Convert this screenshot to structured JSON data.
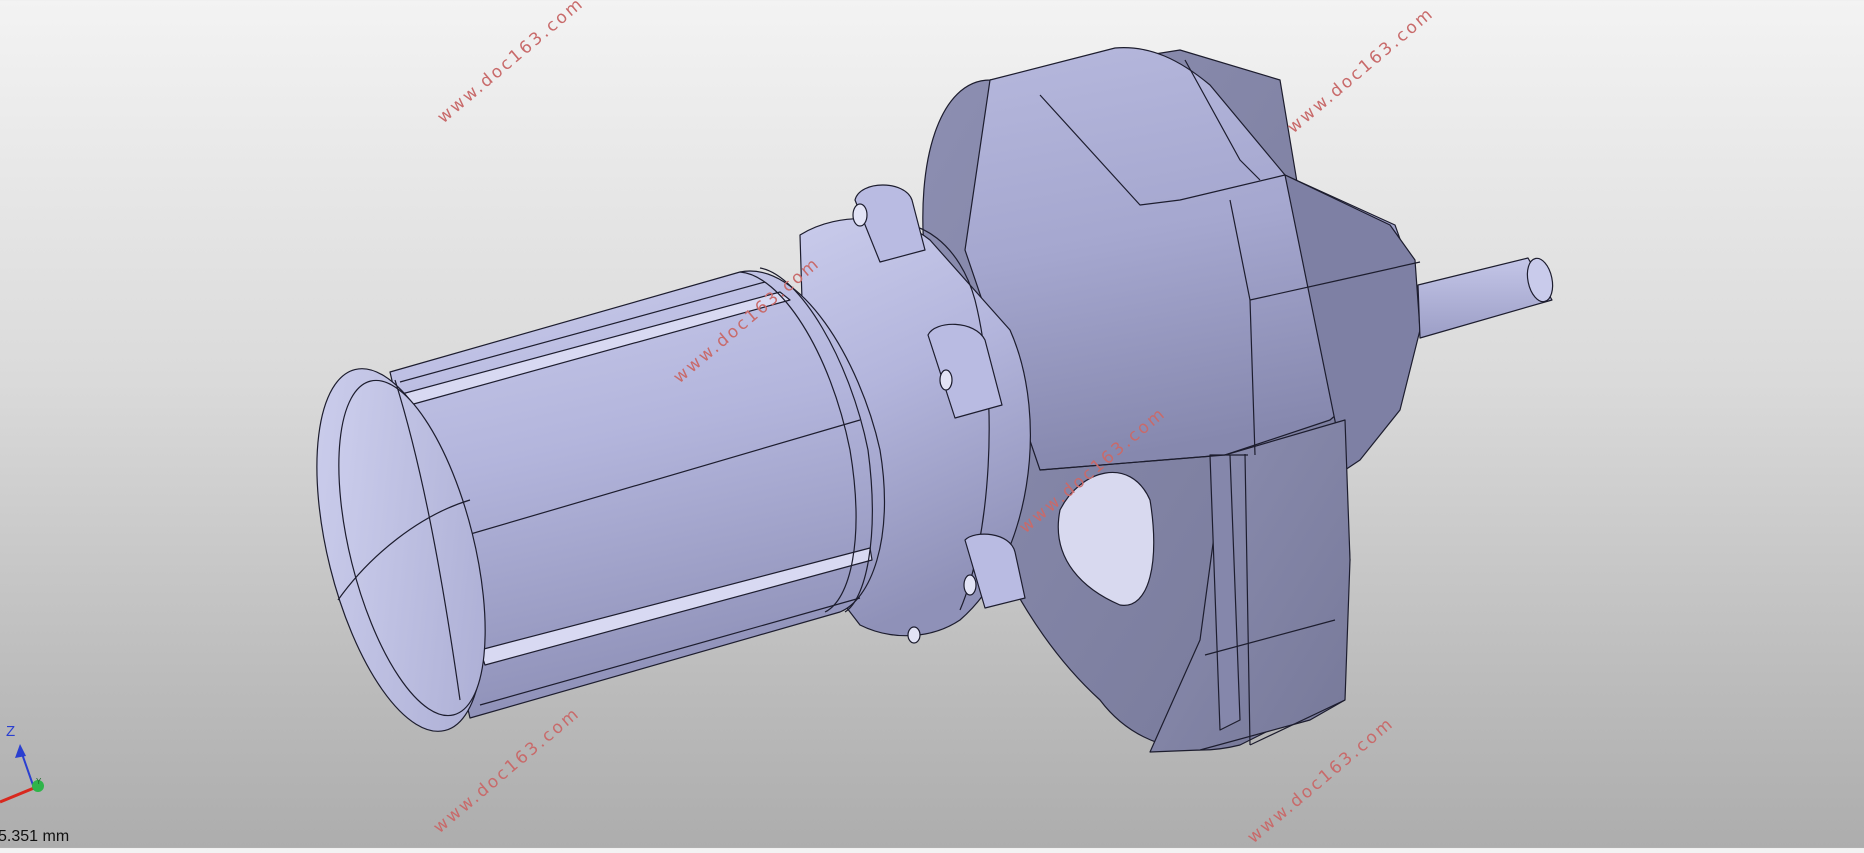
{
  "viewport": {
    "background_top": "#f3f3f3",
    "background_bottom": "#adadad",
    "model_color": "#a3a6cf",
    "edge_color": "#1d1d2e"
  },
  "watermarks": [
    "www.doc163.com",
    "www.doc163.com",
    "www.doc163.com",
    "www.doc163.com",
    "www.doc163.com",
    "www.doc163.com",
    "www.doc163.com"
  ],
  "axis_triad": {
    "z_label": "Z",
    "y_label": "Y"
  },
  "scale": {
    "label": "5.351 mm"
  }
}
